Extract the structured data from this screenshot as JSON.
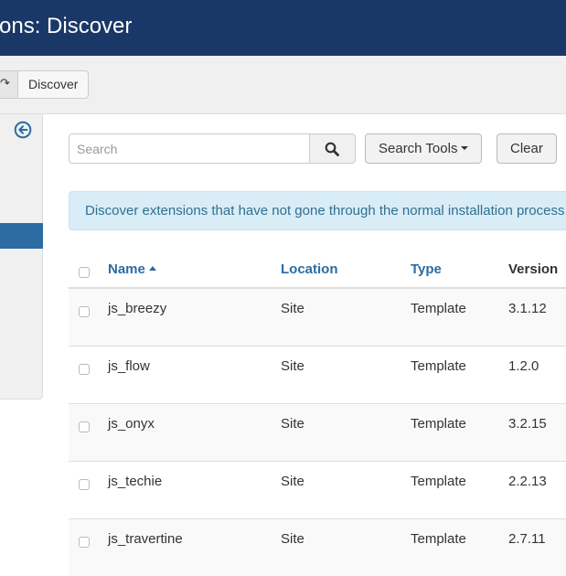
{
  "header": {
    "title": "ons: Discover"
  },
  "toolbar": {
    "discover_label": "Discover",
    "prev_icon": "redo-icon"
  },
  "sidebar": {
    "collapse_icon": "arrow-circle-left-icon"
  },
  "search": {
    "placeholder": "Search",
    "value": "",
    "search_tools_label": "Search Tools",
    "clear_label": "Clear"
  },
  "alert": {
    "text": "Discover extensions that have not gone through the normal installation process."
  },
  "table": {
    "columns": {
      "name": "Name",
      "location": "Location",
      "type": "Type",
      "version": "Version"
    },
    "sort": {
      "column": "name",
      "direction": "asc"
    },
    "rows": [
      {
        "name": "js_breezy",
        "location": "Site",
        "type": "Template",
        "version": "3.1.12"
      },
      {
        "name": "js_flow",
        "location": "Site",
        "type": "Template",
        "version": "1.2.0"
      },
      {
        "name": "js_onyx",
        "location": "Site",
        "type": "Template",
        "version": "3.2.15"
      },
      {
        "name": "js_techie",
        "location": "Site",
        "type": "Template",
        "version": "2.2.13"
      },
      {
        "name": "js_travertine",
        "location": "Site",
        "type": "Template",
        "version": "2.7.11"
      }
    ]
  },
  "colors": {
    "header_bg": "#1a3867",
    "link": "#2a6ca4",
    "active_sidebar": "#2d6ca2",
    "alert_bg": "#d9edf7",
    "alert_text": "#31708f"
  }
}
